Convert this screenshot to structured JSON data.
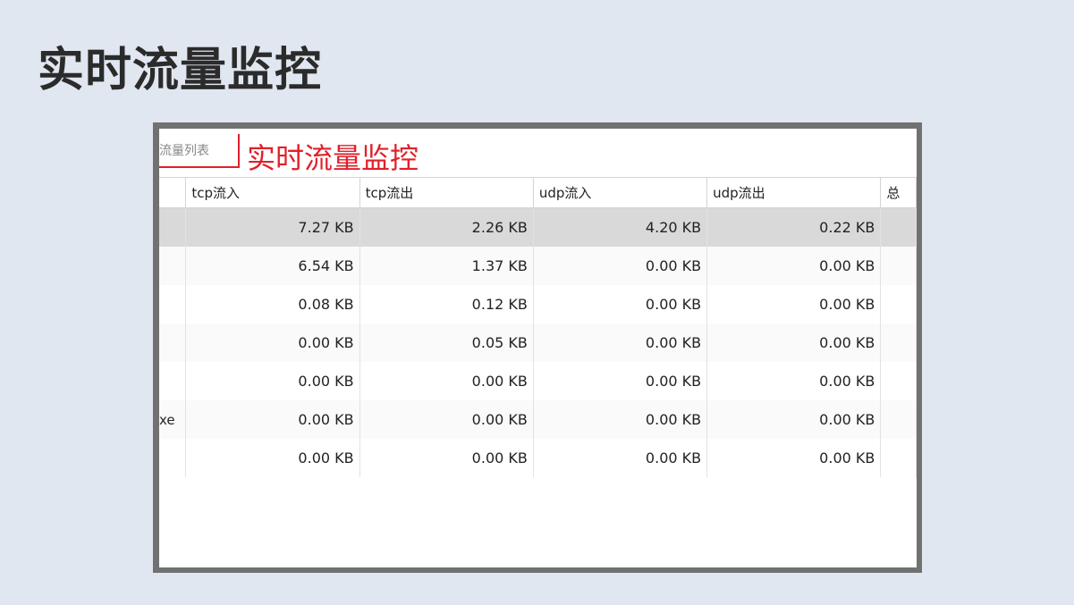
{
  "slide": {
    "title": "实时流量监控"
  },
  "window": {
    "tab_label": "流量列表",
    "annotation": "实时流量监控"
  },
  "table": {
    "columns": [
      "",
      "tcp流入",
      "tcp流出",
      "udp流入",
      "udp流出",
      "总"
    ],
    "rows": [
      {
        "name": "",
        "tcp_in": "7.27 KB",
        "tcp_out": "2.26 KB",
        "udp_in": "4.20 KB",
        "udp_out": "0.22 KB"
      },
      {
        "name": "",
        "tcp_in": "6.54 KB",
        "tcp_out": "1.37 KB",
        "udp_in": "0.00 KB",
        "udp_out": "0.00 KB"
      },
      {
        "name": "",
        "tcp_in": "0.08 KB",
        "tcp_out": "0.12 KB",
        "udp_in": "0.00 KB",
        "udp_out": "0.00 KB"
      },
      {
        "name": "",
        "tcp_in": "0.00 KB",
        "tcp_out": "0.05 KB",
        "udp_in": "0.00 KB",
        "udp_out": "0.00 KB"
      },
      {
        "name": "",
        "tcp_in": "0.00 KB",
        "tcp_out": "0.00 KB",
        "udp_in": "0.00 KB",
        "udp_out": "0.00 KB"
      },
      {
        "name": "xe",
        "tcp_in": "0.00 KB",
        "tcp_out": "0.00 KB",
        "udp_in": "0.00 KB",
        "udp_out": "0.00 KB"
      },
      {
        "name": "",
        "tcp_in": "0.00 KB",
        "tcp_out": "0.00 KB",
        "udp_in": "0.00 KB",
        "udp_out": "0.00 KB"
      }
    ]
  }
}
